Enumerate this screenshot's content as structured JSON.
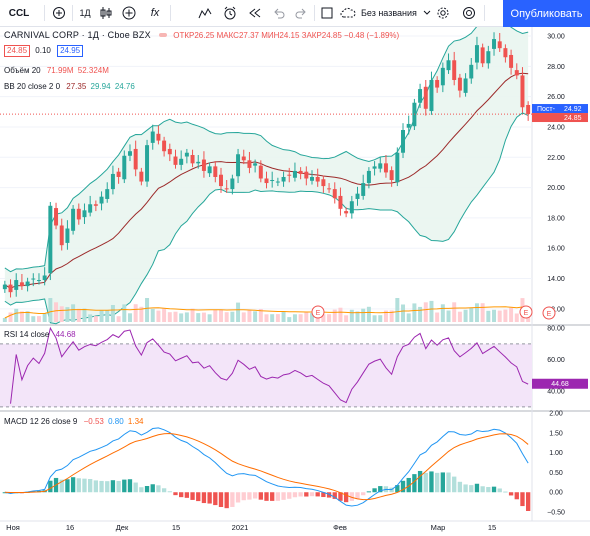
{
  "toolbar": {
    "symbol": "CCL",
    "interval": "1Д",
    "layout_name": "Без названия",
    "publish_label": "Опубликовать",
    "icons": [
      "compare-icon",
      "bar-style-icon",
      "add-indicator-icon",
      "indicators-icon",
      "templates-icon",
      "alert-icon",
      "replay-icon",
      "undo-icon",
      "redo-icon",
      "fullscreen-icon",
      "cloud-icon",
      "settings-icon",
      "camera-icon"
    ]
  },
  "header": {
    "name": "CARNIVAL CORP · 1Д · Cboe BZX",
    "ohlc": "ОТКР26.25 МАКС27.37 МИН24.15 ЗАКР24.85 −0.48 (−1.89%)",
    "bid": "24.85",
    "spread": "0.10",
    "ask": "24.95",
    "volume_label": "Объём 20",
    "volume_value": "71.99M",
    "volume_ma": "52.324M",
    "bb_label": "BB 20 close 2 0",
    "bb_mid": "27.35",
    "bb_up": "29.94",
    "bb_low": "24.76",
    "rsi_label": "RSI 14 close",
    "rsi_value": "44.68",
    "macd_label": "MACD 12 26 close 9",
    "macd_hist": "−0.53",
    "macd_line": "0.80",
    "macd_signal": "1.34",
    "price_tag_post_label": "Пост-",
    "price_tag_post_value": "24.92",
    "price_tag_last": "24.85",
    "earnings_marker": "E"
  },
  "chart_data": [
    {
      "type": "candlestick",
      "title": "CARNIVAL CORP · 1Д · Cboe BZX",
      "price_axis": [
        "30.00",
        "28.00",
        "26.00",
        "24.00",
        "22.00",
        "20.00",
        "18.00",
        "16.00",
        "14.00",
        "12.00"
      ],
      "ylim": [
        11,
        30.2
      ],
      "x_ticks": [
        "Ноя",
        "16",
        "Дек",
        "15",
        "2021",
        "Фев",
        "Мар",
        "15"
      ],
      "closes": [
        13.6,
        13.1,
        13.9,
        13.5,
        13.8,
        14.0,
        13.9,
        14.2,
        18.8,
        17.5,
        16.2,
        17.3,
        18.6,
        17.9,
        18.5,
        18.9,
        18.8,
        19.4,
        19.9,
        20.9,
        20.7,
        22.1,
        22.4,
        21.2,
        20.4,
        22.8,
        23.7,
        23.1,
        22.4,
        22.2,
        21.5,
        21.9,
        22.3,
        21.6,
        21.7,
        21.1,
        21.4,
        20.7,
        20.1,
        19.9,
        20.6,
        22.2,
        21.8,
        21.3,
        21.6,
        20.6,
        20.3,
        20.5,
        20.4,
        20.7,
        20.8,
        21.1,
        20.9,
        20.6,
        20.7,
        20.4,
        20.1,
        19.9,
        19.3,
        18.6,
        18.3,
        19.1,
        19.6,
        20.3,
        21.1,
        21.4,
        21.6,
        21.0,
        20.5,
        22.3,
        23.8,
        24.2,
        25.6,
        26.5,
        25.2,
        27.1,
        26.6,
        27.9,
        28.4,
        27.1,
        26.4,
        27.2,
        28.1,
        29.4,
        28.2,
        29.0,
        29.8,
        29.2,
        28.6,
        27.9,
        27.4,
        25.3,
        24.85
      ],
      "bb_upper_label": "29.94",
      "bb_middle_label": "27.35",
      "bb_lower_label": "24.76"
    },
    {
      "type": "line",
      "title": "RSI 14 close",
      "y_ticks": [
        "80.00",
        "60.00",
        "40.00"
      ],
      "ylim": [
        28,
        82
      ],
      "band": [
        30,
        70
      ],
      "last": 44.68
    },
    {
      "type": "bar",
      "title": "MACD 12 26 close 9",
      "y_ticks": [
        "2.00",
        "1.50",
        "1.00",
        "0.50",
        "0.00",
        "−0.50"
      ],
      "ylim": [
        -0.65,
        2.05
      ],
      "series": [
        {
          "name": "MACD",
          "last": 0.8,
          "color": "#2196f3"
        },
        {
          "name": "Signal",
          "last": 1.34,
          "color": "#ff6d00"
        },
        {
          "name": "Histogram",
          "last": -0.53
        }
      ]
    }
  ],
  "colors": {
    "up": "#26a69a",
    "down": "#ef5350",
    "bb_fill": "#e7f4ef",
    "bb_line": "#26a69a",
    "bb_mid": "#9c2a2a",
    "rsi": "#9c27b0",
    "rsi_band": "#f3e5f9",
    "macd": "#2196f3",
    "signal": "#ff6d00",
    "volume_ma": "#ff9800"
  }
}
